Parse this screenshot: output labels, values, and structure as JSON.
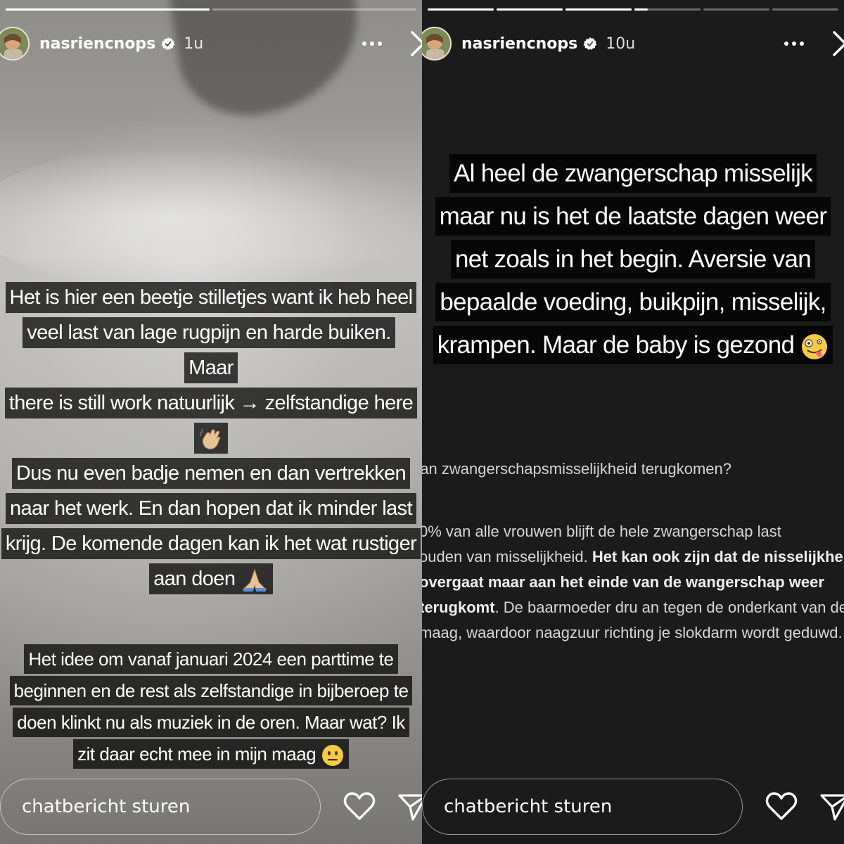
{
  "left_story": {
    "progress": [
      1.0,
      0.0
    ],
    "user": {
      "username": "nasriencnops",
      "time": "1u"
    },
    "captions": {
      "block1": [
        "Het is hier een beetje stilletjes want ik heb heel",
        "veel last van lage rugpijn en harde buiken. Maar",
        "there is still work natuurlijk → zelfstandige here"
      ],
      "block1_emoji": "waving-hand-emoji",
      "block2": [
        "Dus nu even badje nemen en dan vertrekken",
        "naar het werk. En dan hopen dat ik minder last",
        "krijg. De komende dagen kan ik het wat rustiger",
        "aan doen"
      ],
      "block2_emoji": "folded-hands-emoji",
      "block3": [
        "Het idee om vanaf januari 2024 een parttime te",
        "beginnen en de rest als zelfstandige in bijberoep te",
        "doen klinkt nu als muziek in de oren. Maar wat? Ik",
        "zit daar echt mee in mijn maag"
      ],
      "block3_emoji": "neutral-face-emoji"
    },
    "footer": {
      "message_placeholder": "chatbericht sturen",
      "like_icon": "heart-icon",
      "share_icon": "send-icon"
    }
  },
  "right_story": {
    "progress": [
      1.0,
      1.0,
      1.0,
      0.2,
      0.0,
      0.0
    ],
    "user": {
      "username": "nasriencnops",
      "time": "10u"
    },
    "caption": [
      "Al heel de zwangerschap misselijk",
      "maar nu is het de laatste dagen weer",
      "net zoals in het begin. Aversie van",
      "bepaalde voeding, buikpijn, misselijk,",
      "krampen. Maar de baby is gezond"
    ],
    "caption_emoji": "zany-face-emoji",
    "article": {
      "question": "(an zwangerschapsmisselijkheid terugkomen?",
      "paragraph_1": "0% van alle vrouwen blijft de hele zwangerschap last",
      "paragraph_2": "ouden van misselijkheid. ",
      "paragraph_bold": "Het kan ook zijn dat de nisselijkheid overgaat maar aan het einde van de wangerschap weer terugkomt",
      "paragraph_3": ". De baarmoeder dru an tegen de onderkant van de maag, waardoor naagzuur richting je slokdarm wordt geduwd."
    },
    "footer": {
      "message_placeholder": "chatbericht sturen",
      "like_icon": "heart-icon",
      "share_icon": "send-icon"
    }
  },
  "colors": {
    "story_dark_bg": "#1b1b1b",
    "caption_bg": "#000000",
    "text": "#ffffff"
  }
}
